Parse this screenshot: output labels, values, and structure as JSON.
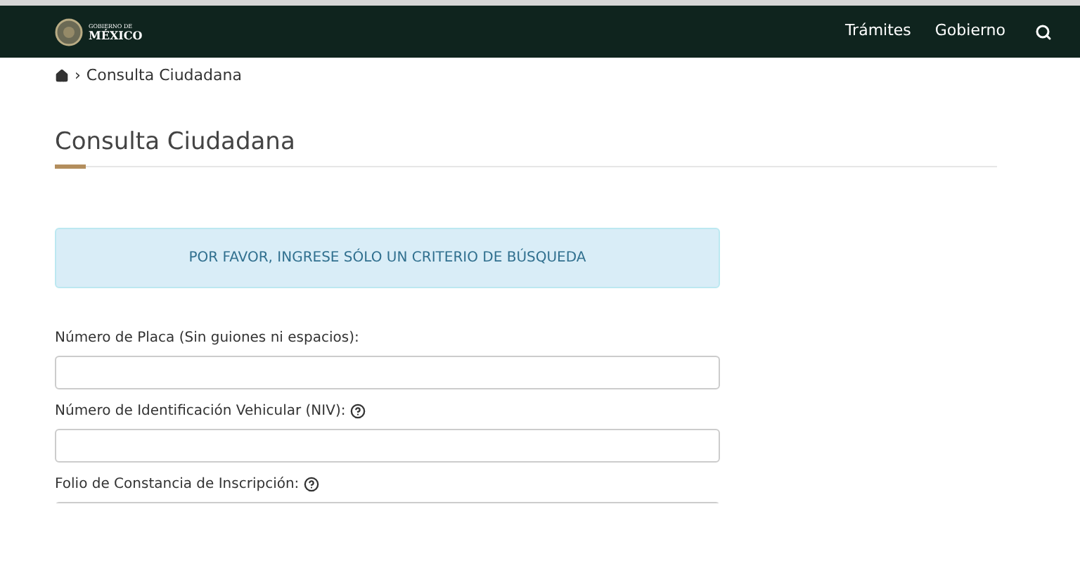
{
  "header": {
    "logo_line_1": "GOBIERNO DE",
    "logo_line_2": "MÉXICO",
    "nav": [
      "Trámites",
      "Gobierno"
    ]
  },
  "breadcrumb": {
    "separator": "›",
    "current": "Consulta Ciudadana"
  },
  "title": "Consulta Ciudadana",
  "alert": "POR FAVOR, INGRESE SÓLO UN CRITERIO DE BÚSQUEDA",
  "fields": [
    {
      "label": "Número de Placa (Sin guiones ni espacios):",
      "help": false
    },
    {
      "label": "Número de Identificación Vehicular (NIV):",
      "help": true
    },
    {
      "label": "Folio de Constancia de Inscripción:",
      "help": true
    }
  ]
}
